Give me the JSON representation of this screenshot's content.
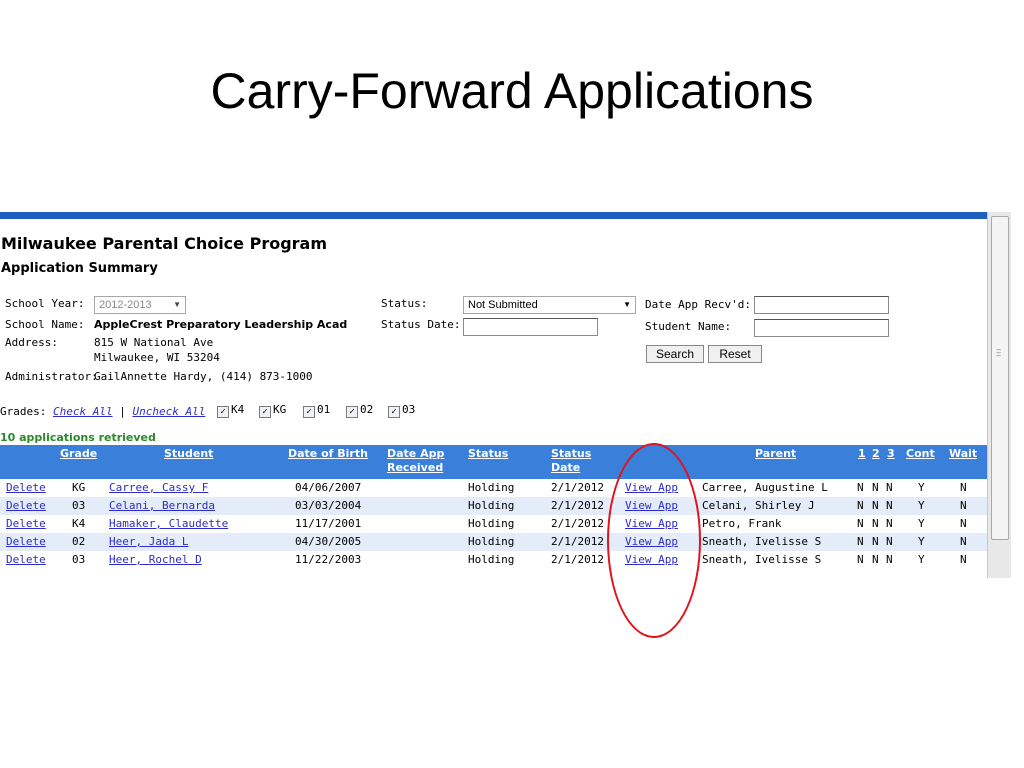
{
  "slide": {
    "title": "Carry-Forward Applications"
  },
  "app": {
    "program_title": "Milwaukee Parental Choice Program",
    "section_title": "Application Summary"
  },
  "form": {
    "school_year_label": "School Year:",
    "school_year_value": "2012-2013",
    "school_name_label": "School Name:",
    "school_name_value": "AppleCrest Preparatory Leadership Acad",
    "address_label": "Address:",
    "address_line1": "815 W National Ave",
    "address_line2": "Milwaukee, WI 53204",
    "administrator_label": "Administrator:",
    "administrator_value": "GailAnnette Hardy, (414) 873-1000",
    "status_label": "Status:",
    "status_value": "Not Submitted",
    "status_date_label": "Status Date:",
    "status_date_value": "",
    "date_recvd_label": "Date App Recv'd:",
    "date_recvd_value": "",
    "student_name_label": "Student Name:",
    "student_name_value": "",
    "search_label": "Search",
    "reset_label": "Reset"
  },
  "grades": {
    "label": "Grades:",
    "check_all": "Check All",
    "separator": "|",
    "uncheck_all": "Uncheck All",
    "options": [
      {
        "label": "K4",
        "checked": true
      },
      {
        "label": "KG",
        "checked": true
      },
      {
        "label": "01",
        "checked": true
      },
      {
        "label": "02",
        "checked": true
      },
      {
        "label": "03",
        "checked": true
      }
    ]
  },
  "results_count": "10 applications retrieved",
  "table": {
    "headers": {
      "grade": "Grade",
      "student": "Student",
      "dob": "Date of Birth",
      "date_app_1": "Date App",
      "date_app_2": "Received",
      "status": "Status",
      "status_date_1": "Status",
      "status_date_2": "Date",
      "parent": "Parent",
      "h1": "1",
      "h2": "2",
      "h3": "3",
      "cont": "Cont",
      "wait": "Wait"
    },
    "rows": [
      {
        "action": "Delete",
        "grade": "KG",
        "student": "Carree, Cassy F",
        "dob": "04/06/2007",
        "received": "",
        "status": "Holding",
        "status_date": "2/1/2012",
        "view": "View App",
        "parent": "Carree, Augustine L",
        "c1": "N",
        "c2": "N",
        "c3": "N",
        "cont": "Y",
        "wait": "N"
      },
      {
        "action": "Delete",
        "grade": "03",
        "student": "Celani, Bernarda",
        "dob": "03/03/2004",
        "received": "",
        "status": "Holding",
        "status_date": "2/1/2012",
        "view": "View App",
        "parent": "Celani, Shirley J",
        "c1": "N",
        "c2": "N",
        "c3": "N",
        "cont": "Y",
        "wait": "N"
      },
      {
        "action": "Delete",
        "grade": "K4",
        "student": "Hamaker, Claudette",
        "dob": "11/17/2001",
        "received": "",
        "status": "Holding",
        "status_date": "2/1/2012",
        "view": "View App",
        "parent": "Petro, Frank",
        "c1": "N",
        "c2": "N",
        "c3": "N",
        "cont": "Y",
        "wait": "N"
      },
      {
        "action": "Delete",
        "grade": "02",
        "student": "Heer, Jada L",
        "dob": "04/30/2005",
        "received": "",
        "status": "Holding",
        "status_date": "2/1/2012",
        "view": "View App",
        "parent": "Sneath, Ivelisse S",
        "c1": "N",
        "c2": "N",
        "c3": "N",
        "cont": "Y",
        "wait": "N"
      },
      {
        "action": "Delete",
        "grade": "03",
        "student": "Heer, Rochel D",
        "dob": "11/22/2003",
        "received": "",
        "status": "Holding",
        "status_date": "2/1/2012",
        "view": "View App",
        "parent": "Sneath, Ivelisse S",
        "c1": "N",
        "c2": "N",
        "c3": "N",
        "cont": "Y",
        "wait": "N"
      }
    ]
  },
  "colors": {
    "header_bg": "#3a7fd9",
    "link": "#2c2cc9",
    "retrieved": "#2a8a2a",
    "highlight": "#e0141c"
  }
}
